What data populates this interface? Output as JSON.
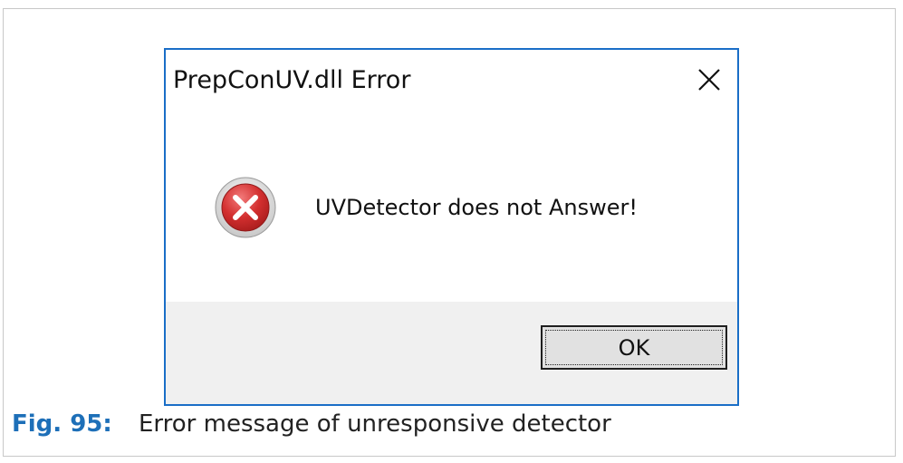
{
  "dialog": {
    "title": "PrepConUV.dll Error",
    "message": "UVDetector does not Answer!",
    "ok_label": "OK",
    "icons": {
      "close": "close-icon",
      "status": "error-icon"
    }
  },
  "caption": {
    "label": "Fig. 95:",
    "text": "Error message of unresponsive detector"
  },
  "colors": {
    "dialog_border": "#1a6ec7",
    "footer_bg": "#f0f0f0",
    "caption_label": "#1d6fb8",
    "error_red": "#d32f2f"
  }
}
